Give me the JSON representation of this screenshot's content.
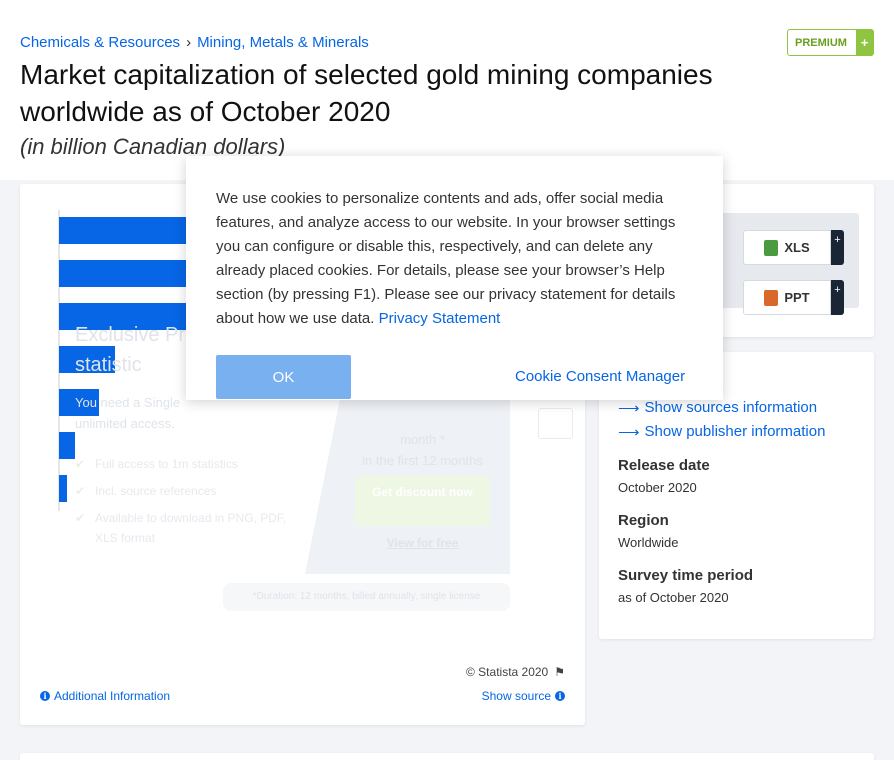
{
  "breadcrumb": {
    "items": [
      "Chemicals & Resources",
      "Mining, Metals & Minerals"
    ],
    "separator": "›"
  },
  "premium": {
    "label": "PREMIUM",
    "plus": "+"
  },
  "title": "Market capitalization of selected gold mining companies worldwide as of October 2020",
  "subtitle": "(in billion Canadian dollars)",
  "colors": {
    "bar": "#0666e5",
    "link": "#0666e5",
    "premium": "#8fc441",
    "dark": "#1a2636"
  },
  "chart_data": {
    "type": "bar",
    "orientation": "horizontal",
    "values": [
      100,
      100,
      47,
      14,
      10,
      4,
      2
    ],
    "visible_fraction_of_axis": [
      1.0,
      1.0,
      0.47,
      0.14,
      0.1,
      0.04,
      0.02
    ]
  },
  "promo": {
    "title_line1": "Exclusive Pr",
    "title_line2": "statistic",
    "need_line1": "You need a Single",
    "need_line2": "unlimited access.",
    "features": [
      "Full access to 1m statistics",
      "Incl. source references",
      "Available to download in PNG, PDF, XLS format"
    ],
    "price_line1": "month *",
    "price_line2": "in the first 12 months",
    "cta": "Get discount now",
    "free_link": "View for free",
    "footnote": "*Duration: 12 months, billed annually, single license"
  },
  "chart_footer": {
    "copyright": "© Statista 2020",
    "additional_info": "Additional Information",
    "show_source": "Show source"
  },
  "downloads": [
    {
      "label": "XLS",
      "plus": "+",
      "icon": "xls-icon",
      "color": "#4a9b3f"
    },
    {
      "label": "PPT",
      "plus": "+",
      "icon": "ppt-icon",
      "color": "#d9682b"
    }
  ],
  "meta": {
    "link_sources": "Show sources information",
    "link_publisher": "Show publisher information",
    "release_date_label": "Release date",
    "release_date": "October 2020",
    "region_label": "Region",
    "region": "Worldwide",
    "survey_label": "Survey time period",
    "survey": "as of October 2020"
  },
  "cookie": {
    "text": "We use cookies to personalize contents and ads, offer social media features, and analyze access to our website. In your browser settings you can configure or disable this, respectively, and can delete any already placed cookies. For details, please see your browser’s Help section (by pressing F1). Please see our privacy statement for details about how we use data.",
    "privacy_link": "Privacy Statement",
    "ok_button": "OK",
    "manager_link": "Cookie Consent Manager"
  }
}
